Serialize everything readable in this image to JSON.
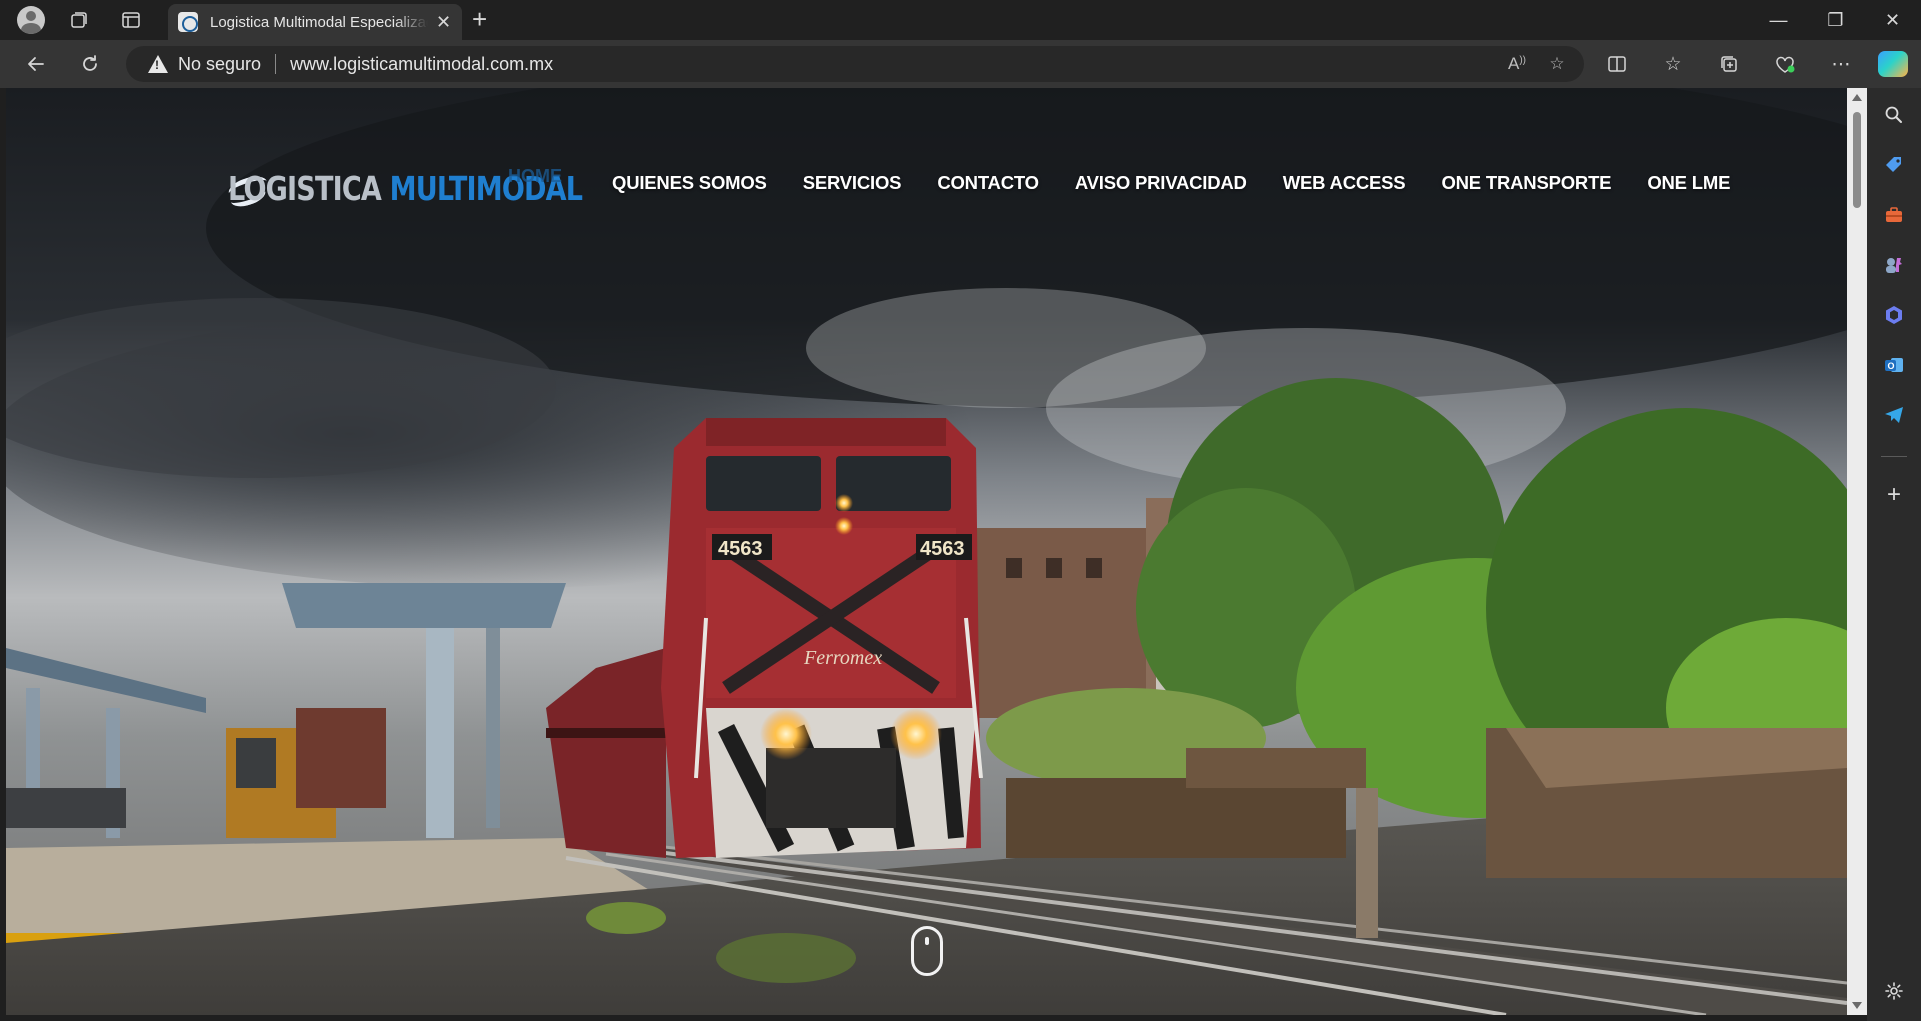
{
  "browser": {
    "tab": {
      "title": "Logistica Multimodal Especializada"
    },
    "address_bar": {
      "security_label": "No seguro",
      "url": "www.logisticamultimodal.com.mx"
    },
    "window_controls": {
      "minimize": "—",
      "restore": "❐",
      "close": "✕"
    },
    "icons": {
      "back": "arrow-left-icon",
      "refresh": "refresh-icon",
      "read_aloud": "read-aloud-icon",
      "favorite": "star-icon",
      "split_screen": "split-screen-icon",
      "favorites": "favorites-icon",
      "collections": "collections-icon",
      "browser_essentials": "heart-pulse-icon",
      "more": "more-icon",
      "copilot": "copilot-icon"
    },
    "sidebar": [
      {
        "name": "search-icon",
        "glyph": "⚲",
        "color": "#dcdcdc"
      },
      {
        "name": "shopping-tag-icon",
        "glyph": "◆",
        "color": "#4f9cf0"
      },
      {
        "name": "tools-icon",
        "glyph": "▰",
        "color": "#e8683a"
      },
      {
        "name": "games-icon",
        "glyph": "♞",
        "color": "#b58bd9"
      },
      {
        "name": "microsoft-365-icon",
        "glyph": "⬢",
        "color": "#6c7df0"
      },
      {
        "name": "outlook-icon",
        "glyph": "O",
        "color": "#1f8ad8"
      },
      {
        "name": "telegram-icon",
        "glyph": "➤",
        "color": "#35a7e8"
      },
      {
        "name": "add-icon",
        "glyph": "+",
        "color": "#dcdcdc"
      },
      {
        "name": "settings-icon",
        "glyph": "⚙",
        "color": "#dcdcdc"
      }
    ]
  },
  "site": {
    "logo": {
      "word1": "LOGISTICA",
      "word2": "MULTIMODAL"
    },
    "home_label": "HOME",
    "menu": [
      "QUIENES SOMOS",
      "SERVICIOS",
      "CONTACTO",
      "AVISO PRIVACIDAD",
      "WEB ACCESS",
      "ONE TRANSPORTE",
      "ONE LME"
    ],
    "hero": {
      "locomotive_number": "4563",
      "locomotive_brand": "Ferromex"
    }
  }
}
